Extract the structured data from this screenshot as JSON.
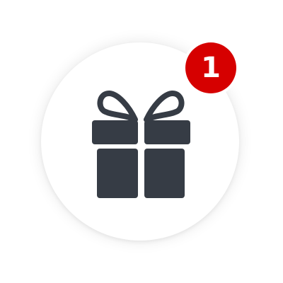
{
  "gift_button": {
    "icon": "gift-icon",
    "icon_color": "#363c45",
    "background": "#ffffff"
  },
  "notification_badge": {
    "count": "1",
    "color": "#d60000",
    "text_color": "#ffffff"
  }
}
